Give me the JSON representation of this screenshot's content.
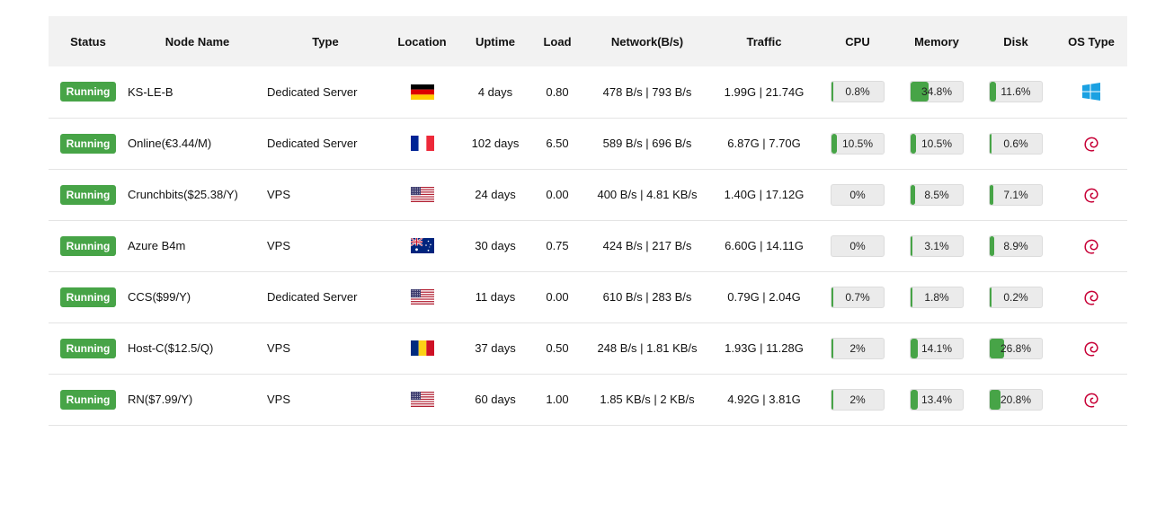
{
  "headers": {
    "status": "Status",
    "node_name": "Node Name",
    "type": "Type",
    "location": "Location",
    "uptime": "Uptime",
    "load": "Load",
    "network": "Network(B/s)",
    "traffic": "Traffic",
    "cpu": "CPU",
    "memory": "Memory",
    "disk": "Disk",
    "os_type": "OS Type"
  },
  "colors": {
    "running": "#47a447",
    "header_bg": "#f2f2f2",
    "bar_bg": "#ebebeb"
  },
  "rows": [
    {
      "status": "Running",
      "name": "KS-LE-B",
      "type": "Dedicated Server",
      "location_flag": "germany-flag",
      "uptime": "4 days",
      "load": "0.80",
      "network": "478 B/s | 793 B/s",
      "traffic": "1.99G | 21.74G",
      "cpu": "0.8%",
      "cpu_pct": 0.8,
      "memory": "34.8%",
      "memory_pct": 34.8,
      "disk": "11.6%",
      "disk_pct": 11.6,
      "os_icon": "windows-icon"
    },
    {
      "status": "Running",
      "name": "Online(€3.44/M)",
      "type": "Dedicated Server",
      "location_flag": "france-flag",
      "uptime": "102 days",
      "load": "6.50",
      "network": "589 B/s | 696 B/s",
      "traffic": "6.87G | 7.70G",
      "cpu": "10.5%",
      "cpu_pct": 10.5,
      "memory": "10.5%",
      "memory_pct": 10.5,
      "disk": "0.6%",
      "disk_pct": 0.6,
      "os_icon": "debian-icon"
    },
    {
      "status": "Running",
      "name": "Crunchbits($25.38/Y)",
      "type": "VPS",
      "location_flag": "usa-flag",
      "uptime": "24 days",
      "load": "0.00",
      "network": "400 B/s | 4.81 KB/s",
      "traffic": "1.40G | 17.12G",
      "cpu": "0%",
      "cpu_pct": 0,
      "memory": "8.5%",
      "memory_pct": 8.5,
      "disk": "7.1%",
      "disk_pct": 7.1,
      "os_icon": "debian-icon"
    },
    {
      "status": "Running",
      "name": "Azure B4m",
      "type": "VPS",
      "location_flag": "australia-flag",
      "uptime": "30 days",
      "load": "0.75",
      "network": "424 B/s | 217 B/s",
      "traffic": "6.60G | 14.11G",
      "cpu": "0%",
      "cpu_pct": 0,
      "memory": "3.1%",
      "memory_pct": 3.1,
      "disk": "8.9%",
      "disk_pct": 8.9,
      "os_icon": "debian-icon"
    },
    {
      "status": "Running",
      "name": "CCS($99/Y)",
      "type": "Dedicated Server",
      "location_flag": "usa-flag",
      "uptime": "11 days",
      "load": "0.00",
      "network": "610 B/s | 283 B/s",
      "traffic": "0.79G | 2.04G",
      "cpu": "0.7%",
      "cpu_pct": 0.7,
      "memory": "1.8%",
      "memory_pct": 1.8,
      "disk": "0.2%",
      "disk_pct": 0.2,
      "os_icon": "debian-icon"
    },
    {
      "status": "Running",
      "name": "Host-C($12.5/Q)",
      "type": "VPS",
      "location_flag": "romania-flag",
      "uptime": "37 days",
      "load": "0.50",
      "network": "248 B/s | 1.81 KB/s",
      "traffic": "1.93G | 11.28G",
      "cpu": "2%",
      "cpu_pct": 2,
      "memory": "14.1%",
      "memory_pct": 14.1,
      "disk": "26.8%",
      "disk_pct": 26.8,
      "os_icon": "debian-icon"
    },
    {
      "status": "Running",
      "name": "RN($7.99/Y)",
      "type": "VPS",
      "location_flag": "usa-flag",
      "uptime": "60 days",
      "load": "1.00",
      "network": "1.85 KB/s | 2 KB/s",
      "traffic": "4.92G | 3.81G",
      "cpu": "2%",
      "cpu_pct": 2,
      "memory": "13.4%",
      "memory_pct": 13.4,
      "disk": "20.8%",
      "disk_pct": 20.8,
      "os_icon": "debian-icon"
    }
  ]
}
